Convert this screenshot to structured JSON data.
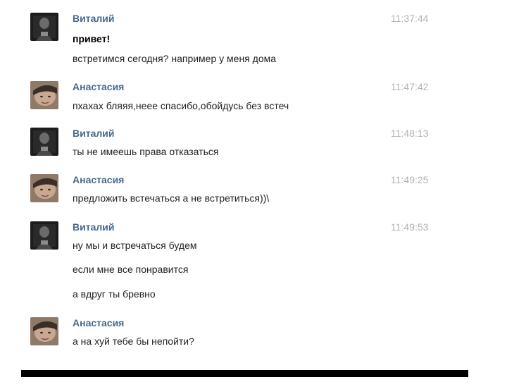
{
  "messages": [
    {
      "author": "Виталий",
      "avatar_icon": "user-avatar-dark-icon",
      "time": "11:37:44",
      "lines": [
        "привет!",
        "встретимся сегодня? например у меня дома"
      ]
    },
    {
      "author": "Анастасия",
      "avatar_icon": "user-avatar-face-icon",
      "time": "11:47:42",
      "lines": [
        "пхахах бляяя,неее спасибо,обойдусь без встеч"
      ]
    },
    {
      "author": "Виталий",
      "avatar_icon": "user-avatar-dark-icon",
      "time": "11:48:13",
      "lines": [
        "ты не имеешь права отказаться"
      ]
    },
    {
      "author": "Анастасия",
      "avatar_icon": "user-avatar-face-icon",
      "time": "11:49:25",
      "lines": [
        "предложить встечаться а не встретиться))\\"
      ]
    },
    {
      "author": "Виталий",
      "avatar_icon": "user-avatar-dark-icon",
      "time": "11:49:53",
      "lines": [
        "ну мы и встречаться будем",
        "если мне все понравится",
        "а вдруг ты бревно"
      ]
    },
    {
      "author": "Анастасия",
      "avatar_icon": "user-avatar-face-icon",
      "time": "",
      "lines": [
        "а на хуй тебе бы непойти?"
      ]
    }
  ],
  "colors": {
    "author": "#45688e",
    "time": "#b2b2b2",
    "text": "#222222"
  }
}
